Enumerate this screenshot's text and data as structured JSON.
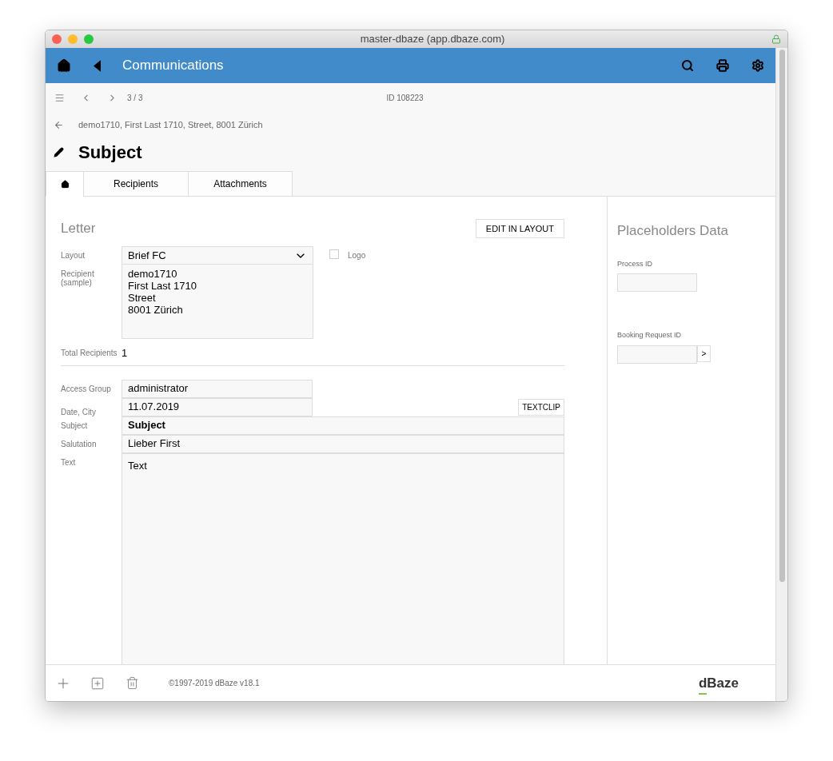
{
  "window": {
    "title": "master-dbaze (app.dbaze.com)"
  },
  "header": {
    "title": "Communications"
  },
  "toolbar": {
    "position": "3 / 3",
    "record_id": "ID 108223"
  },
  "breadcrumb": "demo1710, First Last 1710, Street, 8001 Zürich",
  "page_title": "Subject",
  "tabs": [
    {
      "kind": "icon",
      "selected": true
    },
    {
      "kind": "text",
      "label": "Recipients",
      "selected": false
    },
    {
      "kind": "text",
      "label": "Attachments",
      "selected": false
    }
  ],
  "letter": {
    "title": "Letter",
    "edit_button": "EDIT IN LAYOUT",
    "layout": {
      "label": "Layout",
      "value": "Brief FC"
    },
    "logo": {
      "label": "Logo",
      "checked": false
    },
    "recipient": {
      "label": "Recipient (sample)",
      "lines": [
        "demo1710",
        "First Last 1710",
        "Street",
        "8001 Zürich"
      ]
    },
    "total": {
      "label": "Total Recipients",
      "value": "1"
    },
    "access_group": {
      "label": "Access Group",
      "value": "administrator"
    },
    "date_city": {
      "label": "Date, City",
      "value": "11.07.2019"
    },
    "textclip_button": "TEXTCLIP",
    "subject": {
      "label": "Subject",
      "value": "Subject"
    },
    "salutation": {
      "label": "Salutation",
      "value": "Lieber First"
    },
    "text": {
      "label": "Text",
      "value": "Text"
    }
  },
  "placeholders": {
    "title": "Placeholders Data",
    "fields": [
      {
        "kind": "plain",
        "label": "Process ID"
      },
      {
        "kind": "lookup",
        "label": "Booking Request ID",
        "button": ">"
      }
    ]
  },
  "footer": {
    "copyright": "©1997-2019 dBaze v18.1",
    "logo": "dBaze"
  }
}
